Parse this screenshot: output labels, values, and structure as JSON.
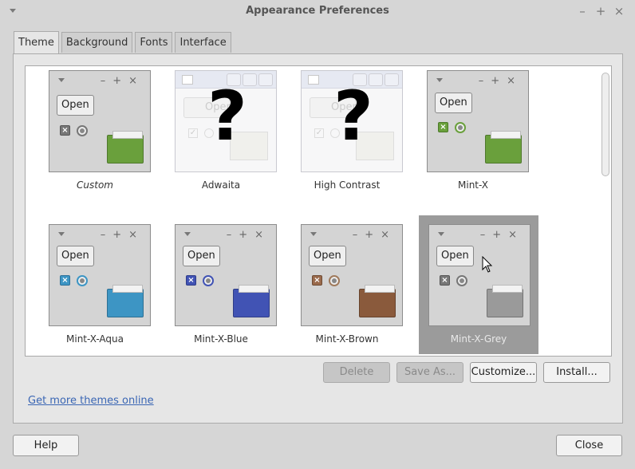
{
  "window": {
    "title": "Appearance Preferences",
    "minimize": "–",
    "maximize": "+",
    "close": "×"
  },
  "tabs": [
    {
      "label": "Theme"
    },
    {
      "label": "Background"
    },
    {
      "label": "Fonts"
    },
    {
      "label": "Interface"
    }
  ],
  "themes": [
    {
      "name": "Custom",
      "open": "Open",
      "folder_color": "#6aa03c",
      "check_color": "#777777",
      "radio_color": "#888888"
    },
    {
      "name": "Adwaita",
      "open": "Open",
      "missing": "?"
    },
    {
      "name": "High Contrast",
      "open": "Open",
      "missing": "?"
    },
    {
      "name": "Mint-X",
      "open": "Open",
      "folder_color": "#6aa03c",
      "check_color": "#6aa03c",
      "radio_color": "#7fb35a"
    },
    {
      "name": "Mint-X-Aqua",
      "open": "Open",
      "folder_color": "#3d95c4",
      "check_color": "#3d95c4",
      "radio_color": "#4a9ccc"
    },
    {
      "name": "Mint-X-Blue",
      "open": "Open",
      "folder_color": "#4153b4",
      "check_color": "#4153b4",
      "radio_color": "#4a5cc0"
    },
    {
      "name": "Mint-X-Brown",
      "open": "Open",
      "folder_color": "#8a5a3c",
      "check_color": "#9a6a4c",
      "radio_color": "#a07a5c"
    },
    {
      "name": "Mint-X-Grey",
      "open": "Open",
      "folder_color": "#9a9a9a",
      "check_color": "#777777",
      "radio_color": "#888888",
      "selected": true
    }
  ],
  "actions": {
    "delete": "Delete",
    "save_as": "Save As...",
    "customize": "Customize...",
    "install": "Install..."
  },
  "link": "Get more themes online",
  "footer": {
    "help": "Help",
    "close": "Close"
  }
}
